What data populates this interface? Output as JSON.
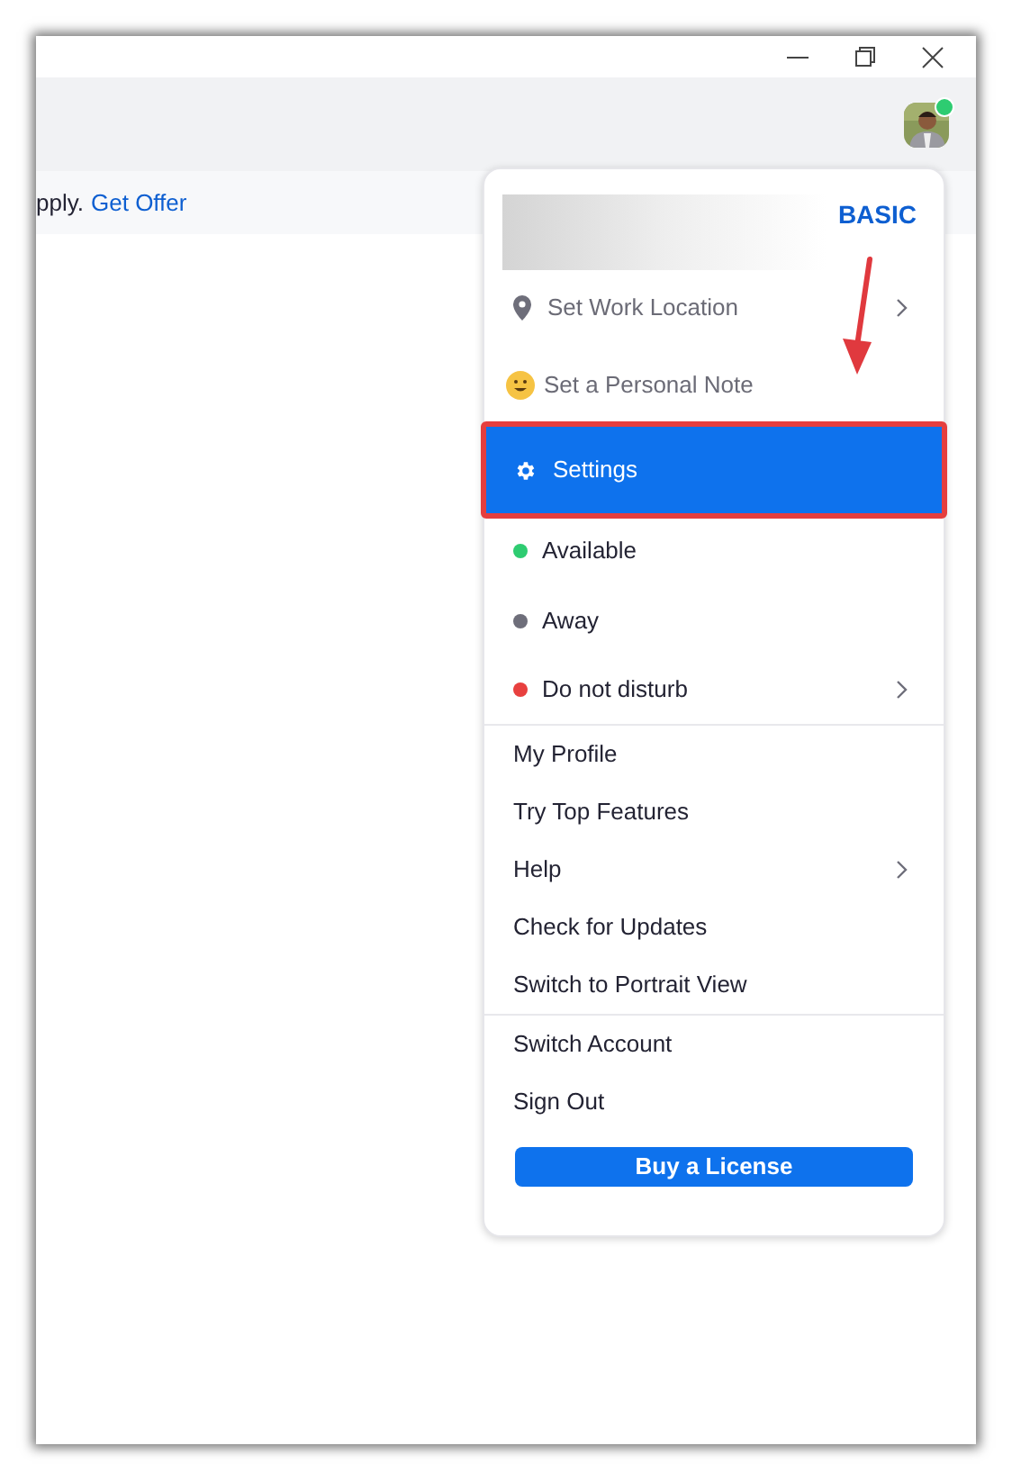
{
  "banner": {
    "text": "pply.",
    "link": "Get Offer"
  },
  "presence": {
    "color": "#2ecc71"
  },
  "menu": {
    "plan": "BASIC",
    "sections": [
      [
        {
          "kind": "pin",
          "label": "Set Work Location",
          "submenu": true,
          "selected": false
        },
        {
          "kind": "emoji",
          "label": "Set a Personal Note",
          "submenu": false,
          "selected": false
        },
        {
          "kind": "gear",
          "label": "Settings",
          "submenu": false,
          "selected": true
        },
        {
          "kind": "status",
          "label": "Available",
          "color": "#2ecc71",
          "submenu": false,
          "selected": false
        },
        {
          "kind": "status",
          "label": "Away",
          "color": "#6e6e7a",
          "submenu": false,
          "selected": false
        },
        {
          "kind": "status",
          "label": "Do not disturb",
          "color": "#e8403f",
          "submenu": true,
          "selected": false
        }
      ],
      [
        {
          "kind": "plain",
          "label": "My Profile",
          "submenu": false,
          "selected": false
        },
        {
          "kind": "plain",
          "label": "Try Top Features",
          "submenu": false,
          "selected": false
        },
        {
          "kind": "plain",
          "label": "Help",
          "submenu": true,
          "selected": false
        },
        {
          "kind": "plain",
          "label": "Check for Updates",
          "submenu": false,
          "selected": false
        },
        {
          "kind": "plain",
          "label": "Switch to Portrait View",
          "submenu": false,
          "selected": false
        }
      ],
      [
        {
          "kind": "plain",
          "label": "Switch Account",
          "submenu": false,
          "selected": false
        },
        {
          "kind": "plain",
          "label": "Sign Out",
          "submenu": false,
          "selected": false
        }
      ]
    ],
    "button": "Buy a License"
  },
  "annotations": {
    "arrow": true,
    "highlight_frame": true
  }
}
